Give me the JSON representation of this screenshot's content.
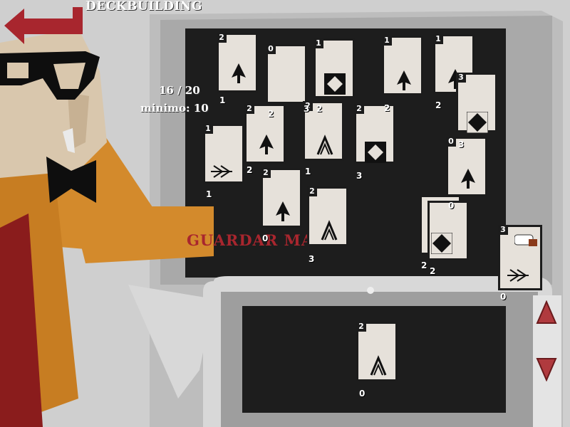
{
  "header": {
    "title": "DECKBUILDING",
    "back_icon": "back-arrow-icon"
  },
  "counter": {
    "count": "16 / 20",
    "minimum": "minimo: 10"
  },
  "save_button": {
    "label": "GUARDAR MAZO"
  },
  "deck_cards": [
    {
      "cost": "2",
      "attack": "1",
      "health": ""
    },
    {
      "cost": "0",
      "attack": "",
      "health": "2"
    },
    {
      "cost": "1",
      "attack": "3",
      "health": "2"
    },
    {
      "cost": "1",
      "attack": "",
      "health": "2"
    },
    {
      "cost": "1",
      "attack": "",
      "health": "2"
    },
    {
      "cost": "3",
      "attack": "",
      "health": "3"
    },
    {
      "cost": "2",
      "attack": "",
      "health": "2"
    },
    {
      "cost": "2",
      "attack": "",
      "health": "1"
    },
    {
      "cost": "2",
      "attack": "",
      "health": "3"
    },
    {
      "cost": "1",
      "attack": "1",
      "health": "2"
    },
    {
      "cost": "0",
      "attack": "",
      "health": "0"
    },
    {
      "cost": "2",
      "attack": "0",
      "health": ""
    },
    {
      "cost": "2",
      "attack": "",
      "health": "3"
    },
    {
      "cost": "",
      "attack": "2",
      "health": "2"
    },
    {
      "cost": "3",
      "attack": "0",
      "health": ""
    }
  ],
  "side_cards": [
    {
      "cost": "3",
      "attack": "0",
      "health": ""
    }
  ],
  "bottom_card": {
    "cost": "2",
    "attack": "0",
    "health": ""
  },
  "scroll": {
    "up_icon": "triangle-up-icon",
    "down_icon": "triangle-down-icon"
  },
  "colors": {
    "accent": "#a8262e",
    "panel": "#1d1d1d",
    "card": "#e6e1da",
    "shirt": "#d38a2c"
  }
}
